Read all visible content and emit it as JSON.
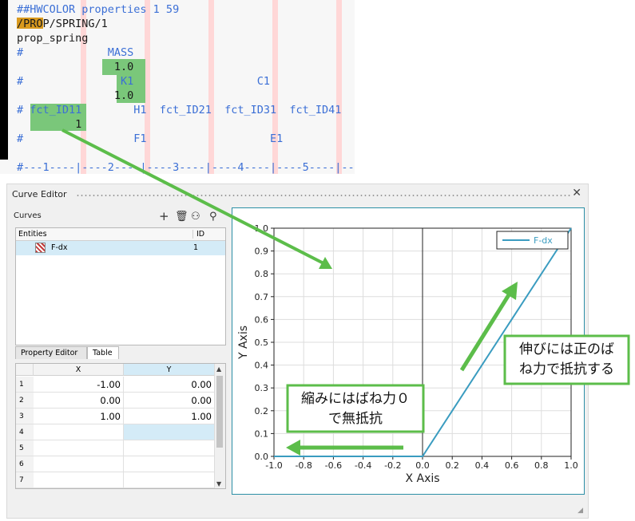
{
  "code": {
    "lines": [
      "##HWCOLOR properties 1 59",
      "/SPRING/1",
      "prop_spring",
      "#             MASS",
      "               1.0",
      "#               K1                   C1",
      "               1.0",
      "# fct_ID11        H1  fct_ID21  fct_ID31  fct_ID41",
      "         1",
      "#                 F1                   E1",
      "",
      "#---1----|----2----|----3----|----4----|----5----|---"
    ],
    "prop_tag": "/PROP"
  },
  "panel": {
    "title": "Curve Editor",
    "close_icon": "close-icon",
    "curves_label": "Curves",
    "toolbar_icons": [
      "add-icon",
      "delete-icon",
      "binoculars-icon",
      "search-icon"
    ],
    "entities_header": {
      "name": "Entities",
      "id": "ID"
    },
    "entities": [
      {
        "name": "F-dx",
        "id": "1",
        "icon": "curve-icon"
      }
    ],
    "tabs": [
      {
        "label": "Property Editor",
        "active": false
      },
      {
        "label": "Table",
        "active": true
      }
    ],
    "table": {
      "headers": [
        "X",
        "Y"
      ],
      "rows": [
        {
          "n": "1",
          "x": "-1.00",
          "y": "0.00"
        },
        {
          "n": "2",
          "x": "0.00",
          "y": "0.00"
        },
        {
          "n": "3",
          "x": "1.00",
          "y": "1.00"
        },
        {
          "n": "4",
          "x": "",
          "y": ""
        },
        {
          "n": "5",
          "x": "",
          "y": ""
        },
        {
          "n": "6",
          "x": "",
          "y": ""
        },
        {
          "n": "7",
          "x": "",
          "y": ""
        }
      ]
    }
  },
  "chart_data": {
    "type": "line",
    "xlabel": "X Axis",
    "ylabel": "Y Axis",
    "xlim": [
      -1.0,
      1.0
    ],
    "ylim": [
      0.0,
      1.0
    ],
    "xticks": [
      "-1.0",
      "-0.8",
      "-0.6",
      "-0.4",
      "-0.2",
      "0.0",
      "0.2",
      "0.4",
      "0.6",
      "0.8",
      "1.0"
    ],
    "yticks": [
      "0.0",
      "0.1",
      "0.2",
      "0.3",
      "0.4",
      "0.5",
      "0.6",
      "0.7",
      "0.8",
      "0.9",
      "1.0"
    ],
    "grid": true,
    "legend_position": "top-right",
    "series": [
      {
        "name": "F-dx",
        "color": "#3a9cc0",
        "x": [
          -1.0,
          0.0,
          1.0
        ],
        "y": [
          0.0,
          0.0,
          1.0
        ]
      }
    ]
  },
  "annotations": {
    "compression_note": "縮みにはばね力０\nで無抵抗",
    "tension_note": "伸びには正のば\nね力で抵抗する",
    "arrow_color": "#5cbd4a"
  }
}
